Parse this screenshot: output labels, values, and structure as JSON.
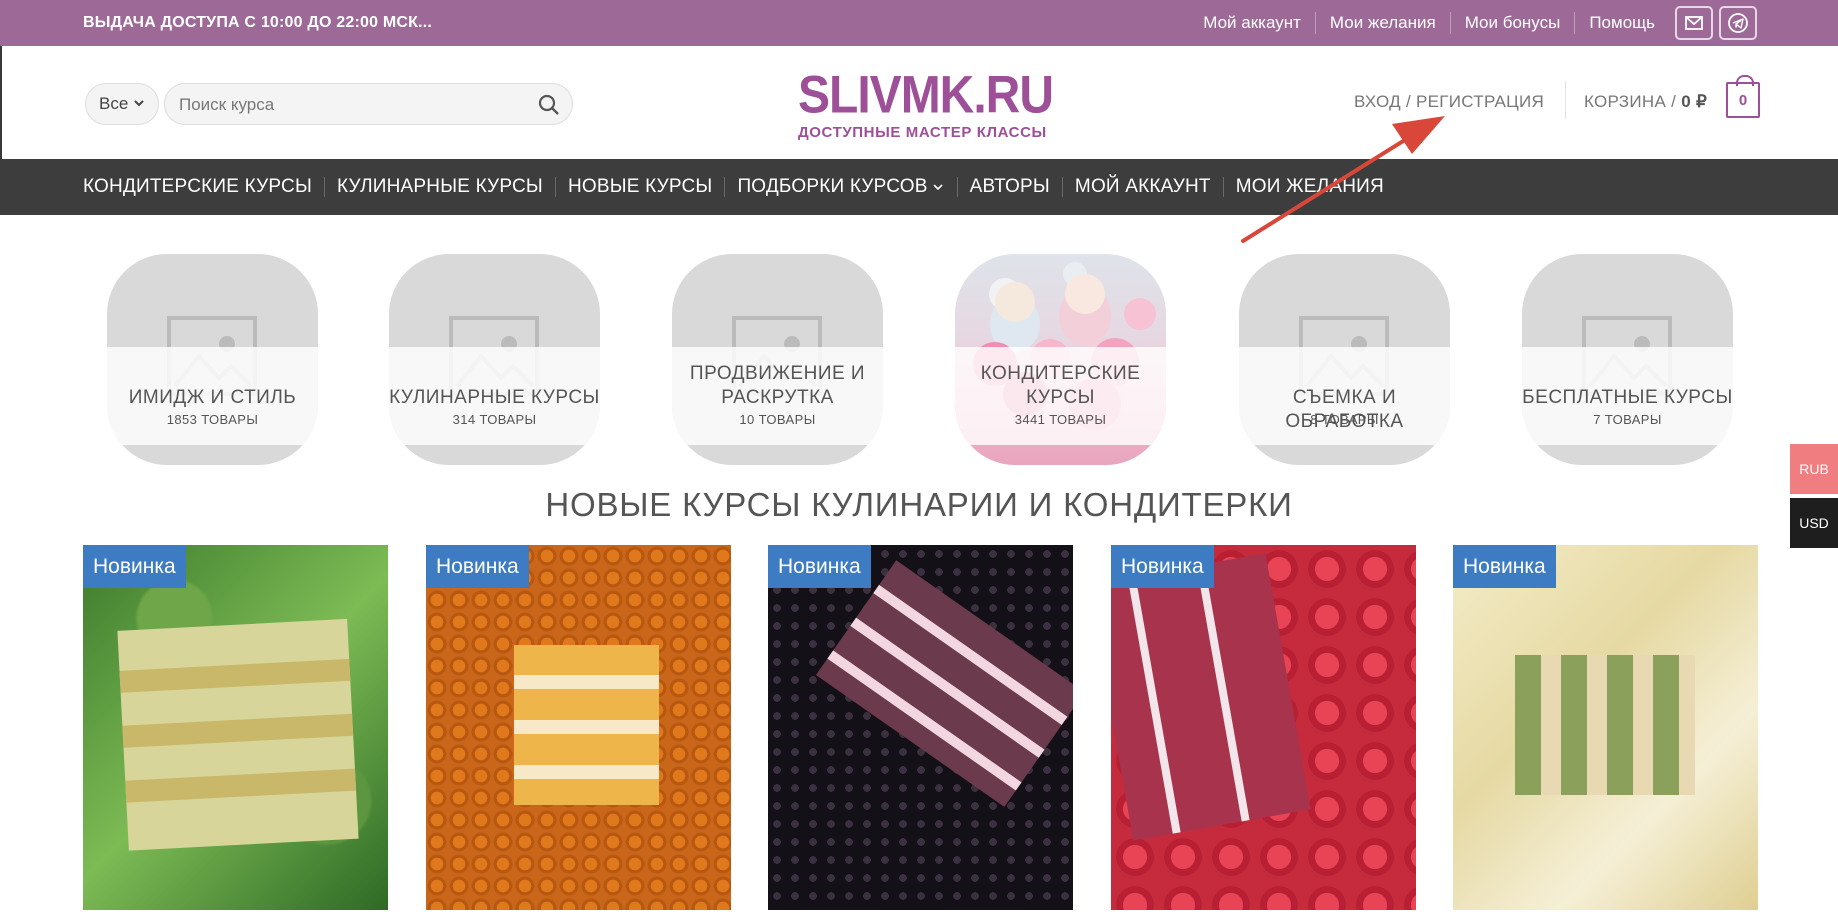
{
  "topbar": {
    "notice": "ВЫДАЧА ДОСТУПА С 10:00 ДО 22:00 МСК...",
    "links": [
      "Мой аккаунт",
      "Мои желания",
      "Мои бонусы",
      "Помощь"
    ],
    "icons": [
      "mail-icon",
      "telegram-icon"
    ],
    "bg_color": "#9d6997"
  },
  "header": {
    "category_select": "Все",
    "search_placeholder": "Поиск курса",
    "logo_main": "SLIVMK.RU",
    "logo_sub": "ДОСТУПНЫЕ МАСТЕР КЛАССЫ",
    "login": "ВХОД / РЕГИСТРАЦИЯ",
    "cart_label": "КОРЗИНА /",
    "cart_total": "0 ₽",
    "cart_count": "0"
  },
  "nav": {
    "items": [
      "КОНДИТЕРСКИЕ КУРСЫ",
      "КУЛИНАРНЫЕ КУРСЫ",
      "НОВЫЕ КУРСЫ",
      "ПОДБОРКИ КУРСОВ",
      "АВТОРЫ",
      "МОЙ АККАУНТ",
      "МОИ ЖЕЛАНИЯ"
    ]
  },
  "categories": [
    {
      "name": "ИМИДЖ И СТИЛЬ",
      "count": "1853 ТОВАРЫ"
    },
    {
      "name": "КУЛИНАРНЫЕ КУРСЫ",
      "count": "314 ТОВАРЫ"
    },
    {
      "name_line1": "ПРОДВИЖЕНИЕ И",
      "name_line2": "РАСКРУТКА",
      "count": "10 ТОВАРЫ"
    },
    {
      "name_line1": "КОНДИТЕРСКИЕ",
      "name_line2": "КУРСЫ",
      "count": "3441 ТОВАРЫ"
    },
    {
      "name": "СЪЕМКА И ОБРАБОТКА",
      "count": "8 ТОВАРЫ"
    },
    {
      "name": "БЕСПЛАТНЫЕ КУРСЫ",
      "count": "7 ТОВАРЫ"
    }
  ],
  "section_title": "НОВЫЕ КУРСЫ КУЛИНАРИИ И КОНДИТЕРКИ",
  "products": [
    {
      "badge": "Новинка"
    },
    {
      "badge": "Новинка"
    },
    {
      "badge": "Новинка"
    },
    {
      "badge": "Новинка"
    },
    {
      "badge": "Новинка"
    }
  ],
  "currency": {
    "rub": "RUB",
    "usd": "USD"
  },
  "colors": {
    "accent": "#9d4f97",
    "nav": "#3d3d3d",
    "badge": "#3d7cc2",
    "arrow": "#d9473b"
  }
}
